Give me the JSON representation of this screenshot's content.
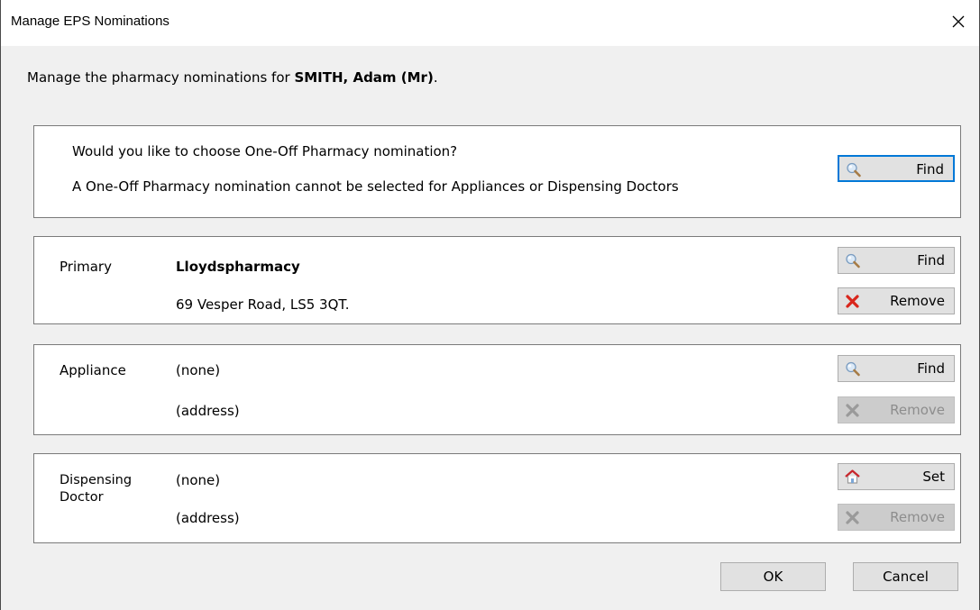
{
  "window": {
    "title": "Manage EPS Nominations"
  },
  "intro": {
    "prefix": "Manage the pharmacy nominations for ",
    "patient": "SMITH, Adam (Mr)",
    "suffix": "."
  },
  "one_off": {
    "question": "Would you like to choose One-Off Pharmacy nomination?",
    "note": "A One-Off Pharmacy nomination cannot be selected for Appliances or Dispensing Doctors",
    "find_label": "Find"
  },
  "primary": {
    "label": "Primary",
    "name": "Lloydspharmacy",
    "address": "69 Vesper Road, LS5 3QT.",
    "find_label": "Find",
    "remove_label": "Remove"
  },
  "appliance": {
    "label": "Appliance",
    "name": "(none)",
    "address": "(address)",
    "find_label": "Find",
    "remove_label": "Remove"
  },
  "dispensing_doctor": {
    "label": "Dispensing Doctor",
    "name": "(none)",
    "address": "(address)",
    "set_label": "Set",
    "remove_label": "Remove"
  },
  "footer": {
    "ok_label": "OK",
    "cancel_label": "Cancel"
  },
  "icons": {
    "find": "magnifier-icon",
    "remove": "red-x-icon",
    "set": "house-icon",
    "close": "close-icon"
  },
  "colors": {
    "focus_border": "#0078d7",
    "remove_red": "#d9261c",
    "disabled_text": "#8d8d8d"
  }
}
